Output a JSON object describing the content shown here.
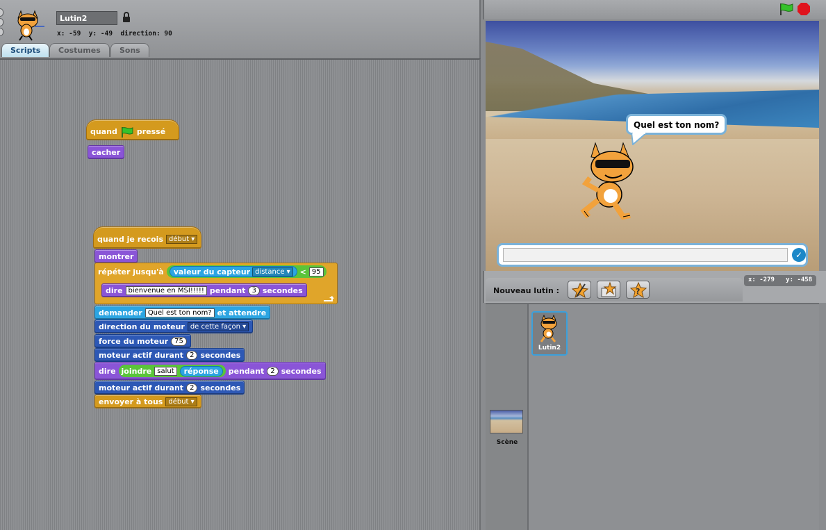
{
  "sprite": {
    "name": "Lutin2",
    "info": "x: -59  y: -49  direction: 90"
  },
  "tabs": [
    {
      "label": "Scripts"
    },
    {
      "label": "Costumes"
    },
    {
      "label": "Sons"
    }
  ],
  "scripts": {
    "s1": {
      "when_label": "quand",
      "pressed_label": "pressé",
      "hide": "cacher"
    },
    "s2": {
      "when_receive": "quand je recois",
      "receive_msg": "début",
      "show": "montrer",
      "repeat_until": "répéter jusqu'à",
      "sensor_value": "valeur du capteur",
      "sensor_name": "distance",
      "lt": "<",
      "threshold": "95",
      "say_label": "dire",
      "say_text": "bienvenue en MSI!!!!!",
      "for_label": "pendant",
      "say_secs": "3",
      "seconds": "secondes",
      "ask": "demander",
      "ask_text": "Quel est ton nom?",
      "and_wait": "et attendre",
      "motor_dir": "direction du moteur",
      "motor_dir_val": "de cette façon",
      "motor_power": "force du moteur",
      "motor_power_val": "75",
      "motor_on_for": "moteur actif durant",
      "motor_secs1": "2",
      "say2_label": "dire",
      "join": "joindre",
      "join_a": "salut",
      "join_b": "réponse",
      "say2_secs": "2",
      "motor_secs2": "2",
      "broadcast": "envoyer à tous",
      "broadcast_msg": "début"
    }
  },
  "stage": {
    "speech": "Quel est ton nom?",
    "coords": "x: -279   y: -458"
  },
  "sprite_corral": {
    "new_sprite_label": "Nouveau lutin :",
    "sprite_label": "Lutin2",
    "scene_label": "Scène"
  },
  "colors": {
    "events": "#d49a1e",
    "looks": "#8a55d7",
    "sensing": "#2ca5e2",
    "motor": "#2d58b5",
    "accent": "#3ba0db"
  }
}
